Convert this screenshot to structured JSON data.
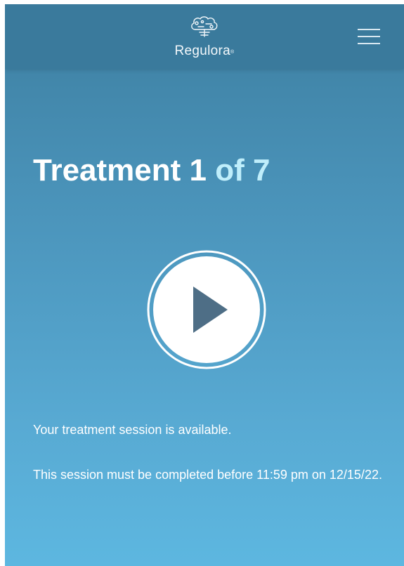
{
  "header": {
    "brand_name": "Regulora",
    "brand_mark": "®",
    "logo_icon": "brain-gears-icon",
    "menu_icon": "hamburger-menu-icon"
  },
  "treatment": {
    "title_prefix": "Treatment 1",
    "title_suffix": "of 7"
  },
  "player": {
    "play_icon": "play-icon"
  },
  "messages": {
    "available": "Your treatment session is available.",
    "deadline": "This session must be completed before 11:59 pm on 12/15/22."
  },
  "colors": {
    "header_bg": "#3a7a9c",
    "gradient_top": "#3d7fa1",
    "gradient_bottom": "#5db7e0",
    "accent_text": "#bfeefb",
    "play_triangle": "#4e6e86"
  }
}
